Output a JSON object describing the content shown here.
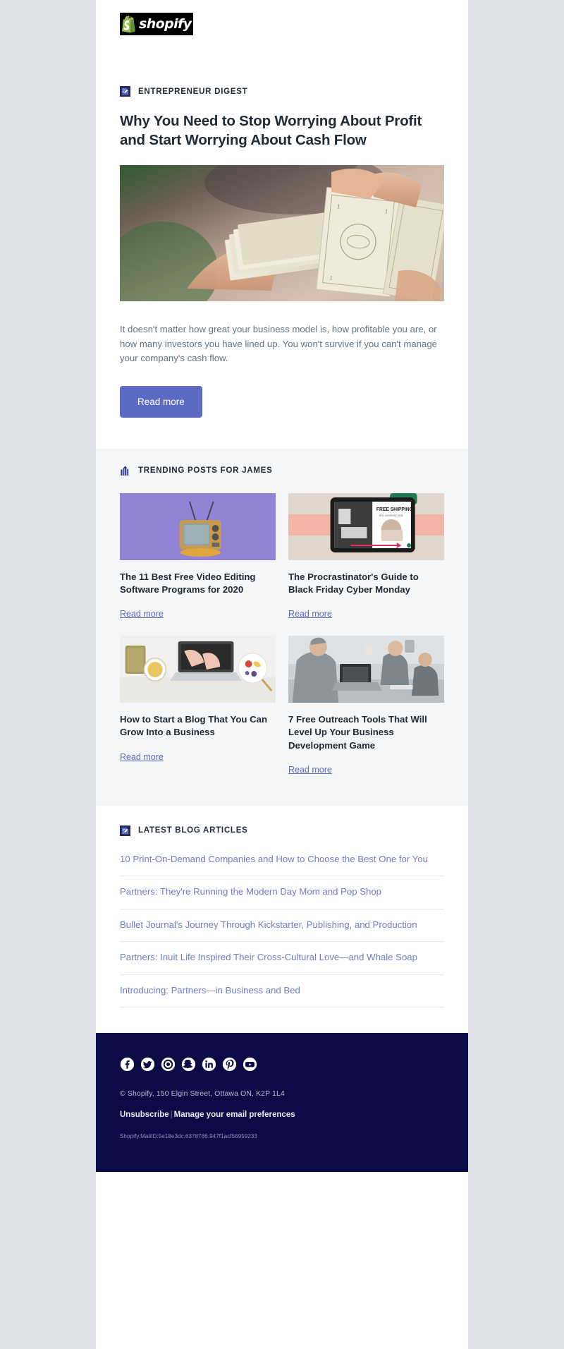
{
  "brand": {
    "logo_word": "shopify",
    "accent_indigo": "#5c6ac4",
    "ink": "#212b36",
    "muted": "#637381",
    "footer_bg": "#0b0b45",
    "page_bg": "#dfe3e8",
    "trending_bg": "#f4f6f8"
  },
  "hero": {
    "eyebrow": "ENTREPRENEUR DIGEST",
    "eyebrow_icon": "document-edit-icon",
    "headline": "Why You Need to Stop Worrying About Profit and Start Worrying About Cash Flow",
    "image_alt": "hands-holding-fanned-dollar-bills",
    "description": "It doesn't matter how great your business model is, how profitable you are, or how many investors you have lined up. You won't survive if you can't manage your company's cash flow.",
    "cta_label": "Read more"
  },
  "trending": {
    "label": "TRENDING POSTS FOR JAMES",
    "label_icon": "trending-bars-icon",
    "read_more_label": "Read more",
    "posts": [
      {
        "title": "The 11 Best Free Video Editing Software Programs for 2020",
        "image_alt": "retro-television-on-purple-background",
        "link_label": "Read more"
      },
      {
        "title": "The Procrastinator's Guide to Black Friday Cyber Monday",
        "image_alt": "tablet-showing-free-shipping-promo",
        "link_label": "Read more"
      },
      {
        "title": "How to Start a Blog That You Can Grow Into a Business",
        "image_alt": "hands-typing-on-laptop-with-tea-and-fruit",
        "link_label": "Read more"
      },
      {
        "title": "7 Free Outreach Tools That Will Level Up Your Business Development Game",
        "image_alt": "people-working-at-desks-in-office",
        "link_label": "Read more"
      }
    ]
  },
  "latest": {
    "label": "LATEST BLOG ARTICLES",
    "label_icon": "document-edit-icon",
    "articles": [
      "10 Print-On-Demand Companies and How to Choose the Best One for You",
      "Partners: They're Running the Modern Day Mom and Pop Shop",
      "Bullet Journal's Journey Through Kickstarter, Publishing, and Production",
      "Partners: Inuit Life Inspired Their Cross-Cultural Love—and Whale Soap",
      "Introducing: Partners—in Business and Bed"
    ]
  },
  "footer": {
    "socials": [
      "facebook-icon",
      "twitter-icon",
      "instagram-icon",
      "snapchat-icon",
      "linkedin-icon",
      "pinterest-icon",
      "youtube-icon"
    ],
    "address": "© Shopify,  150 Elgin Street, Ottawa ON, K2P 1L4",
    "unsubscribe_label": "Unsubscribe",
    "separator": "|",
    "preferences_label": "Manage your email preferences",
    "mail_id": "Shopify.MailID:5e18e3dc.6378786.947f1acf56959233"
  }
}
